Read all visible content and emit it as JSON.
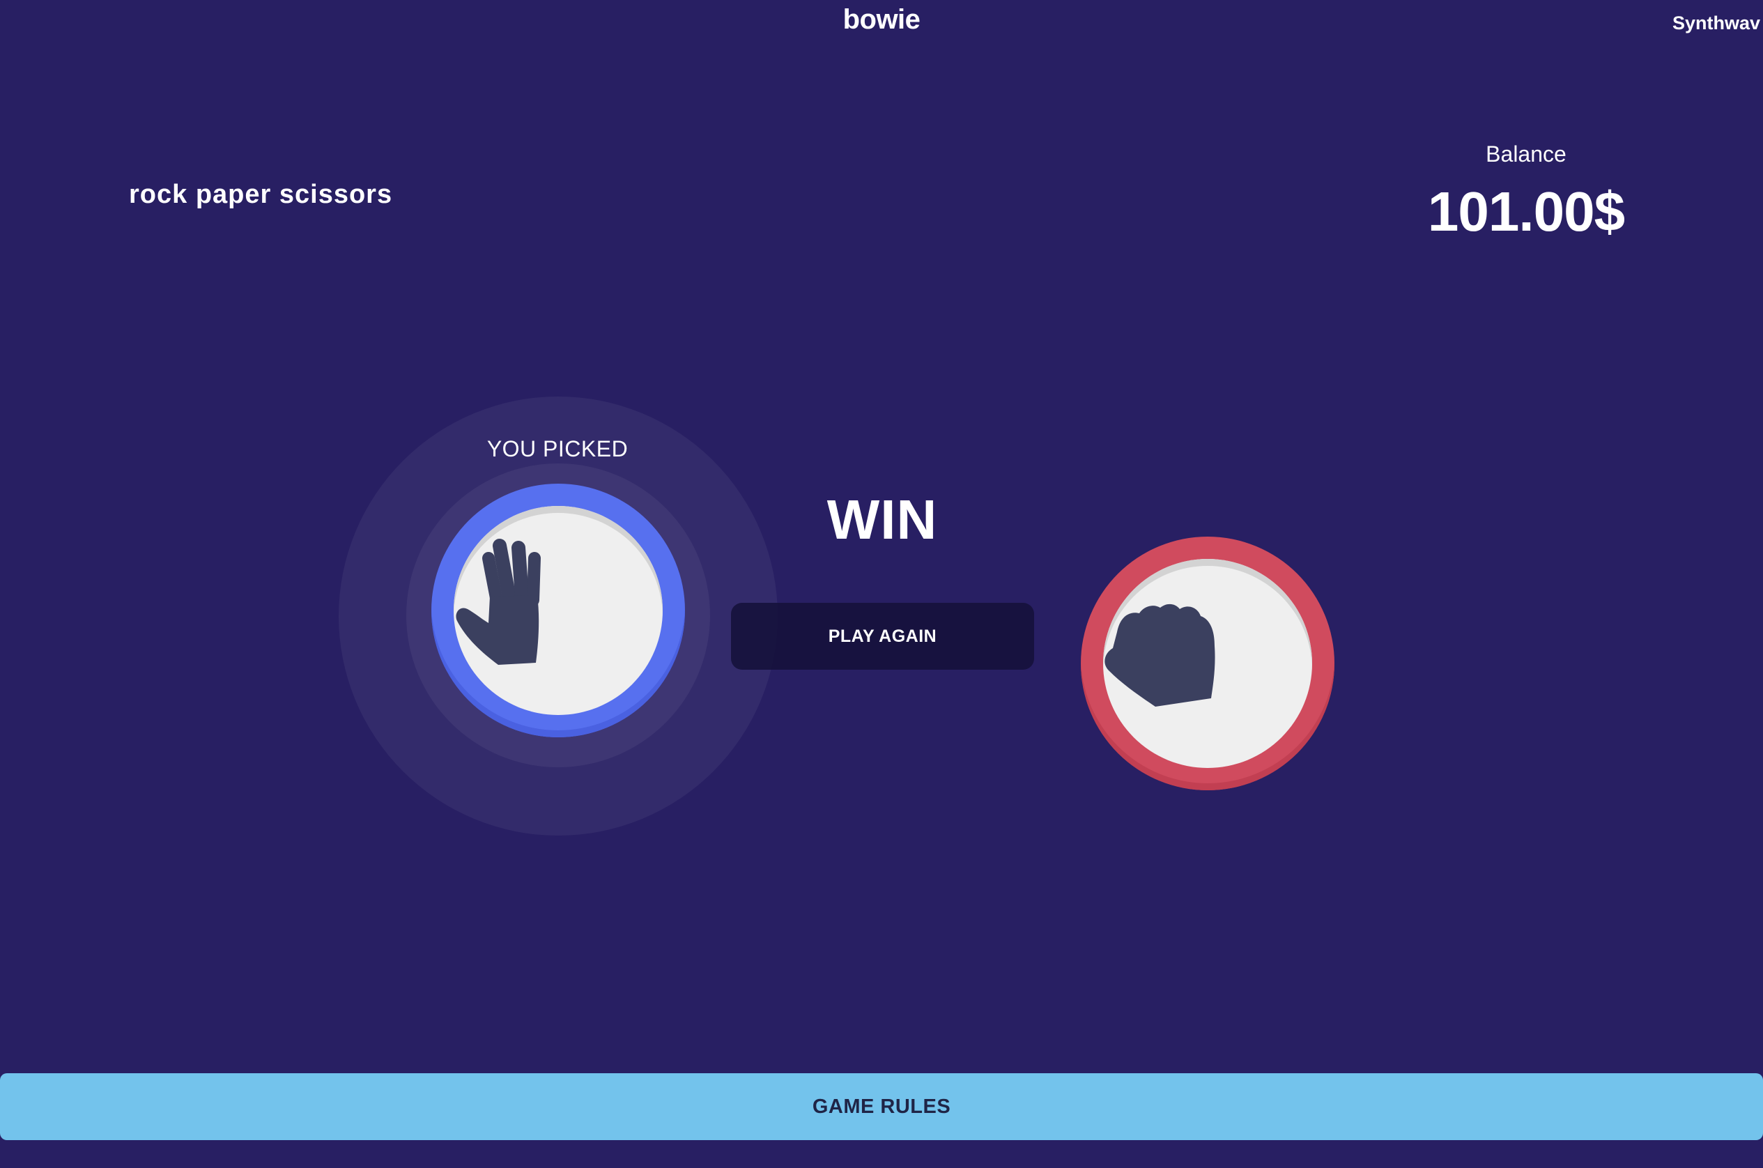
{
  "header": {
    "app_title": "bowie",
    "theme_label": "Synthwav"
  },
  "game": {
    "title": "rock paper scissors"
  },
  "balance": {
    "label": "Balance",
    "value": "101.00$"
  },
  "player": {
    "label": "YOU PICKED",
    "choice_icon": "paper-hand-icon",
    "token_color": "#5770ef"
  },
  "house": {
    "choice_icon": "rock-fist-icon",
    "token_color": "#d04b5e"
  },
  "result": {
    "text": "WIN",
    "play_again_label": "PLAY AGAIN"
  },
  "footer": {
    "rules_label": "GAME RULES"
  },
  "colors": {
    "background": "#281f63",
    "rules_button": "#73c3ec",
    "icon": "#3b405f"
  }
}
